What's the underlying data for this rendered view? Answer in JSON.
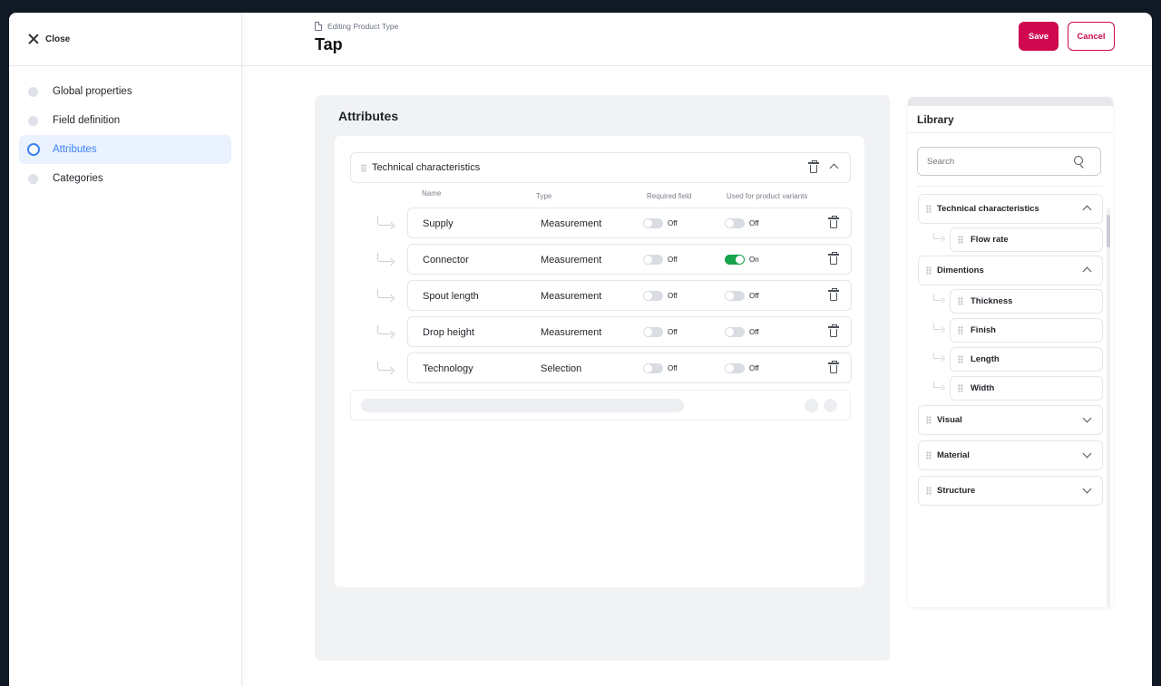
{
  "sidebar": {
    "close_label": "Close",
    "items": [
      {
        "label": "Global properties"
      },
      {
        "label": "Field definition"
      },
      {
        "label": "Attributes"
      },
      {
        "label": "Categories"
      }
    ]
  },
  "header": {
    "breadcrumb": "Editing Product Type",
    "title": "Tap",
    "save_label": "Save",
    "cancel_label": "Cancel"
  },
  "attributes": {
    "title": "Attributes",
    "group": {
      "label": "Technical characteristics"
    },
    "columns": {
      "name": "Name",
      "type": "Type",
      "required": "Required field",
      "variants": "Used for product variants"
    },
    "rows": [
      {
        "name": "Supply",
        "type": "Measurement",
        "required": "Off",
        "variants": "Off"
      },
      {
        "name": "Connector",
        "type": "Measurement",
        "required": "Off",
        "variants": "On"
      },
      {
        "name": "Spout length",
        "type": "Measurement",
        "required": "Off",
        "variants": "Off"
      },
      {
        "name": "Drop height",
        "type": "Measurement",
        "required": "Off",
        "variants": "Off"
      },
      {
        "name": "Technology",
        "type": "Selection",
        "required": "Off",
        "variants": "Off"
      }
    ]
  },
  "library": {
    "title": "Library",
    "search_placeholder": "Search",
    "groups": [
      {
        "label": "Technical characteristics",
        "items": [
          "Flow rate"
        ]
      },
      {
        "label": "Dimentions",
        "items": [
          "Thickness",
          "Finish",
          "Length",
          "Width"
        ]
      },
      {
        "label": "Visual",
        "items": []
      },
      {
        "label": "Material",
        "items": []
      },
      {
        "label": "Structure",
        "items": []
      }
    ]
  },
  "colors": {
    "accent": "#d0084f",
    "active_nav": "#3b82f6",
    "toggle_on": "#16a34a"
  }
}
